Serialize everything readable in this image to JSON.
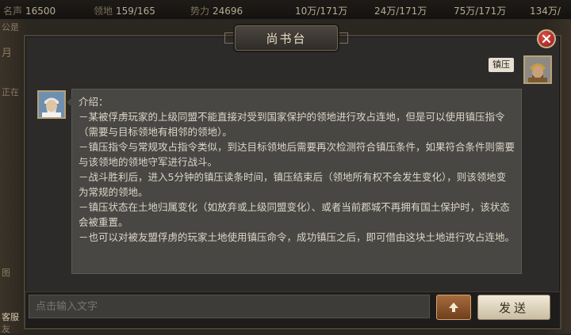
{
  "topbar": {
    "fame_label": "名声",
    "fame_value": "16500",
    "territory_label": "领地",
    "territory_value": "159/165",
    "power_label": "势力",
    "power_value": "24696",
    "res1": "10万/171万",
    "res2": "24万/171万",
    "res3": "75万/171万",
    "res4": "134万/"
  },
  "left_edge": {
    "frag1": "公是",
    "frag2": "月",
    "frag3": "正在",
    "frag4": "图",
    "frag5": "客服",
    "frag6": "友"
  },
  "dialog": {
    "title": "尚书台",
    "sender_name": "镇压",
    "message_lines": [
      "介绍：",
      "－某被俘虏玩家的上级同盟不能直接对受到国家保护的领地进行攻占连地，但是可以使用镇压指令（需要与目标领地有相邻的领地）。",
      "－镇压指令与常规攻占指令类似，到达目标领地后需要再次检测符合镇压条件，如果符合条件则需要与该领地的领地守军进行战斗。",
      "－战斗胜利后，进入5分钟的镇压读条时间，镇压结束后（领地所有权不会发生变化），则该领地变为常规的领地。",
      "－镇压状态在土地归属变化（如放弃或上级同盟变化）、或者当前郡城不再拥有国土保护时，该状态会被重置。",
      "－也可以对被友盟俘虏的玩家土地使用镇压命令，成功镇压之后，即可借由这块土地进行攻占连地。"
    ],
    "input_placeholder": "点击输入文字",
    "send_label": "发送"
  },
  "colors": {
    "accent": "#c9b48a",
    "close": "#b02a24",
    "bubble": "#484744"
  },
  "icons": {
    "close": "close-icon",
    "up": "arrow-up-icon"
  }
}
